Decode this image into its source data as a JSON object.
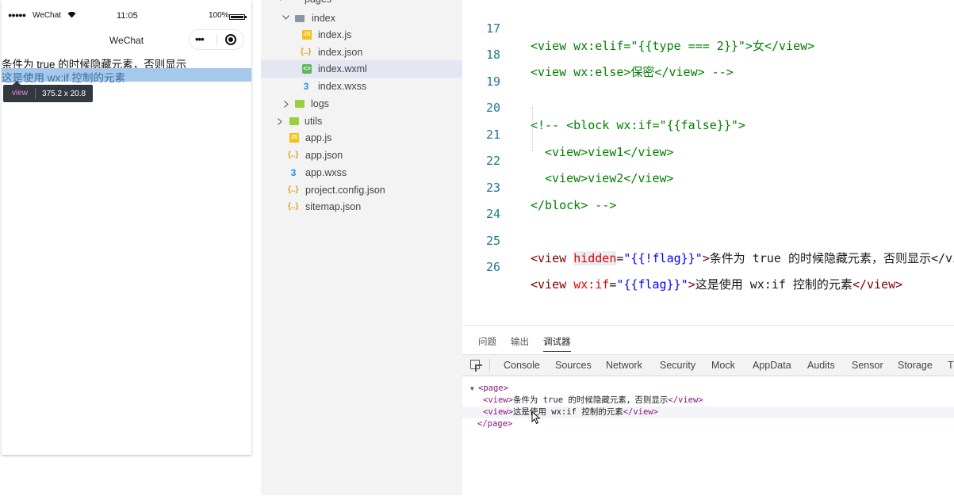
{
  "simulator": {
    "status": {
      "signal": "●●●●●",
      "carrier": "WeChat",
      "time": "11:05",
      "battery": "100%"
    },
    "navbar_title": "WeChat",
    "capsule_dots": "•••",
    "page_lines": [
      "条件为 true 的时候隐藏元素，否则显示",
      "这是使用 wx:if 控制的元素"
    ],
    "inspector": {
      "tag": "view",
      "size": "375.2 x 20.8"
    }
  },
  "file_tree": {
    "items": [
      "pages",
      "index",
      "index.js",
      "index.json",
      "index.wxml",
      "index.wxss",
      "logs",
      "utils",
      "app.js",
      "app.json",
      "app.wxss",
      "project.config.json",
      "sitemap.json"
    ],
    "selected": "index.wxml"
  },
  "editor": {
    "line_numbers": [
      "17",
      "18",
      "19",
      "20",
      "21",
      "22",
      "23",
      "24",
      "25",
      "26"
    ],
    "lines": {
      "l17": {
        "code": "<view wx:elif=\"{{type === 2}}\">女</view>"
      },
      "l18": {
        "code": "<view wx:else>保密</view> -->"
      },
      "l20": {
        "code": "<!-- <block wx:if=\"{{false}}\">"
      },
      "l21": {
        "code": "<view>view1</view>"
      },
      "l22": {
        "code": "<view>view2</view>"
      },
      "l23": {
        "code": "</block> -->"
      },
      "l25": {
        "open": "<view ",
        "attr": "hidden",
        "eq": "=",
        "val": "\"{{!flag}}\"",
        "close": ">",
        "text": "条件为 true 的时候隐藏元素，否则显示</view>"
      },
      "l26": {
        "open": "<view ",
        "attr": "wx:if",
        "eq": "=",
        "val": "\"{{flag}}\"",
        "close": ">",
        "text": "这是使用 wx:if 控制的元素",
        "end": "</view>"
      }
    }
  },
  "bottom_panel": {
    "tabs": [
      "问题",
      "输出",
      "调试器"
    ],
    "active_tab": "调试器",
    "devtools_tabs": [
      "Console",
      "Sources",
      "Network",
      "Security",
      "Mock",
      "AppData",
      "Audits",
      "Sensor",
      "Storage",
      "Tr"
    ],
    "elements": {
      "page_open": "<page>",
      "view_open": "<view>",
      "view_close": "</view>",
      "text1": "条件为 true 的时候隐藏元素，否则显示",
      "text2": "这是使用 wx:if 控制的元素",
      "page_close": "</page>",
      "expand_arrow": "▼"
    }
  },
  "icons": {
    "tree_expanded": "chevron-down-icon",
    "tree_collapsed": "chevron-right-icon",
    "inspect": "inspect-element-icon",
    "cursor": "mouse-pointer-icon"
  },
  "colors": {
    "highlight": "#a6c8ea",
    "tag": "#800000",
    "attr": "#e50000",
    "value": "#0000ff",
    "comment": "#008000",
    "line_number": "#237893"
  }
}
